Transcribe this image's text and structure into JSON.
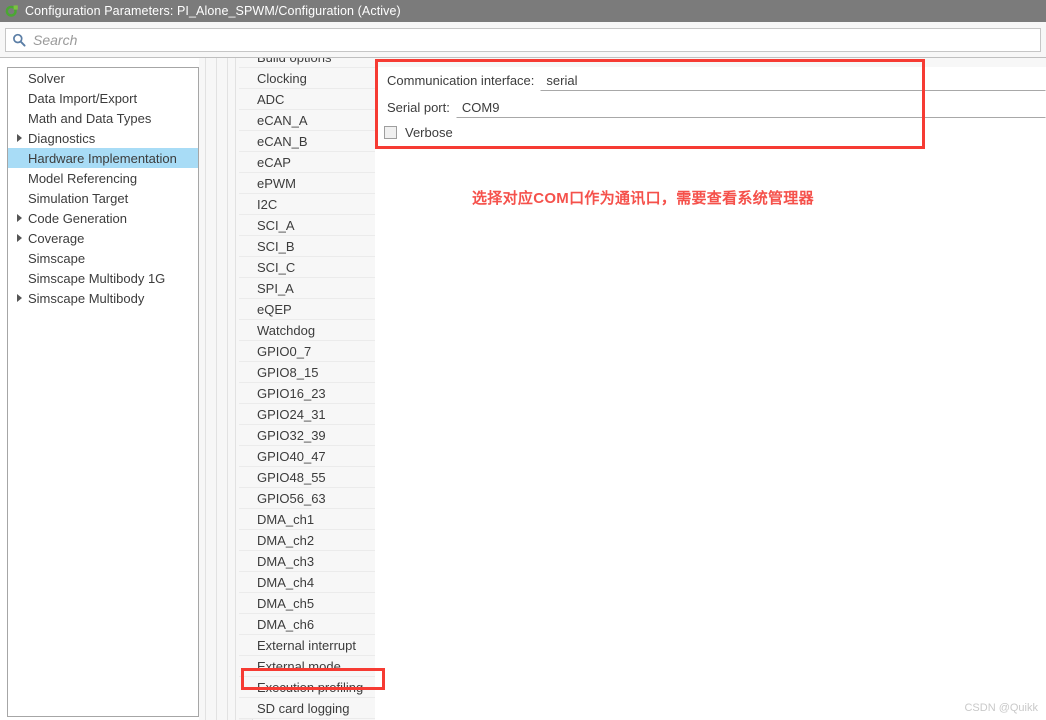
{
  "window": {
    "title": "Configuration Parameters: PI_Alone_SPWM/Configuration (Active)",
    "icon": "simulink-config-icon"
  },
  "search": {
    "placeholder": "Search",
    "value": "",
    "icon": "search-icon"
  },
  "tree": {
    "items": [
      {
        "label": "Solver",
        "expandable": false,
        "selected": false
      },
      {
        "label": "Data Import/Export",
        "expandable": false,
        "selected": false
      },
      {
        "label": "Math and Data Types",
        "expandable": false,
        "selected": false
      },
      {
        "label": "Diagnostics",
        "expandable": true,
        "selected": false
      },
      {
        "label": "Hardware Implementation",
        "expandable": false,
        "selected": true
      },
      {
        "label": "Model Referencing",
        "expandable": false,
        "selected": false
      },
      {
        "label": "Simulation Target",
        "expandable": false,
        "selected": false
      },
      {
        "label": "Code Generation",
        "expandable": true,
        "selected": false
      },
      {
        "label": "Coverage",
        "expandable": true,
        "selected": false
      },
      {
        "label": "Simscape",
        "expandable": false,
        "selected": false
      },
      {
        "label": "Simscape Multibody 1G",
        "expandable": false,
        "selected": false
      },
      {
        "label": "Simscape Multibody",
        "expandable": true,
        "selected": false
      }
    ]
  },
  "grouplist": {
    "items": [
      {
        "label": "Build options"
      },
      {
        "label": "Clocking"
      },
      {
        "label": "ADC"
      },
      {
        "label": "eCAN_A"
      },
      {
        "label": "eCAN_B"
      },
      {
        "label": "eCAP"
      },
      {
        "label": "ePWM"
      },
      {
        "label": "I2C"
      },
      {
        "label": "SCI_A"
      },
      {
        "label": "SCI_B"
      },
      {
        "label": "SCI_C"
      },
      {
        "label": "SPI_A"
      },
      {
        "label": "eQEP"
      },
      {
        "label": "Watchdog"
      },
      {
        "label": "GPIO0_7"
      },
      {
        "label": "GPIO8_15"
      },
      {
        "label": "GPIO16_23"
      },
      {
        "label": "GPIO24_31"
      },
      {
        "label": "GPIO32_39"
      },
      {
        "label": "GPIO40_47"
      },
      {
        "label": "GPIO48_55"
      },
      {
        "label": "GPIO56_63"
      },
      {
        "label": "DMA_ch1"
      },
      {
        "label": "DMA_ch2"
      },
      {
        "label": "DMA_ch3"
      },
      {
        "label": "DMA_ch4"
      },
      {
        "label": "DMA_ch5"
      },
      {
        "label": "DMA_ch6"
      },
      {
        "label": "External interrupt"
      },
      {
        "label": "External mode"
      },
      {
        "label": "Execution profiling"
      },
      {
        "label": "SD card logging"
      }
    ],
    "highlighted": "External mode"
  },
  "form": {
    "communication_interface": {
      "label": "Communication interface:",
      "value": "serial"
    },
    "serial_port": {
      "label": "Serial port:",
      "value": "COM9"
    },
    "verbose": {
      "label": "Verbose",
      "checked": false
    }
  },
  "annotation": {
    "text": "选择对应COM口作为通讯口，需要查看系统管理器",
    "color": "#f5514b"
  },
  "watermark": {
    "text": "CSDN @Quikk"
  },
  "colors": {
    "titlebar_bg": "#7b7b7b",
    "selection_bg": "#a8dcf6",
    "annotation_red": "#f63b33",
    "panel_bg": "#f7f7f7"
  }
}
